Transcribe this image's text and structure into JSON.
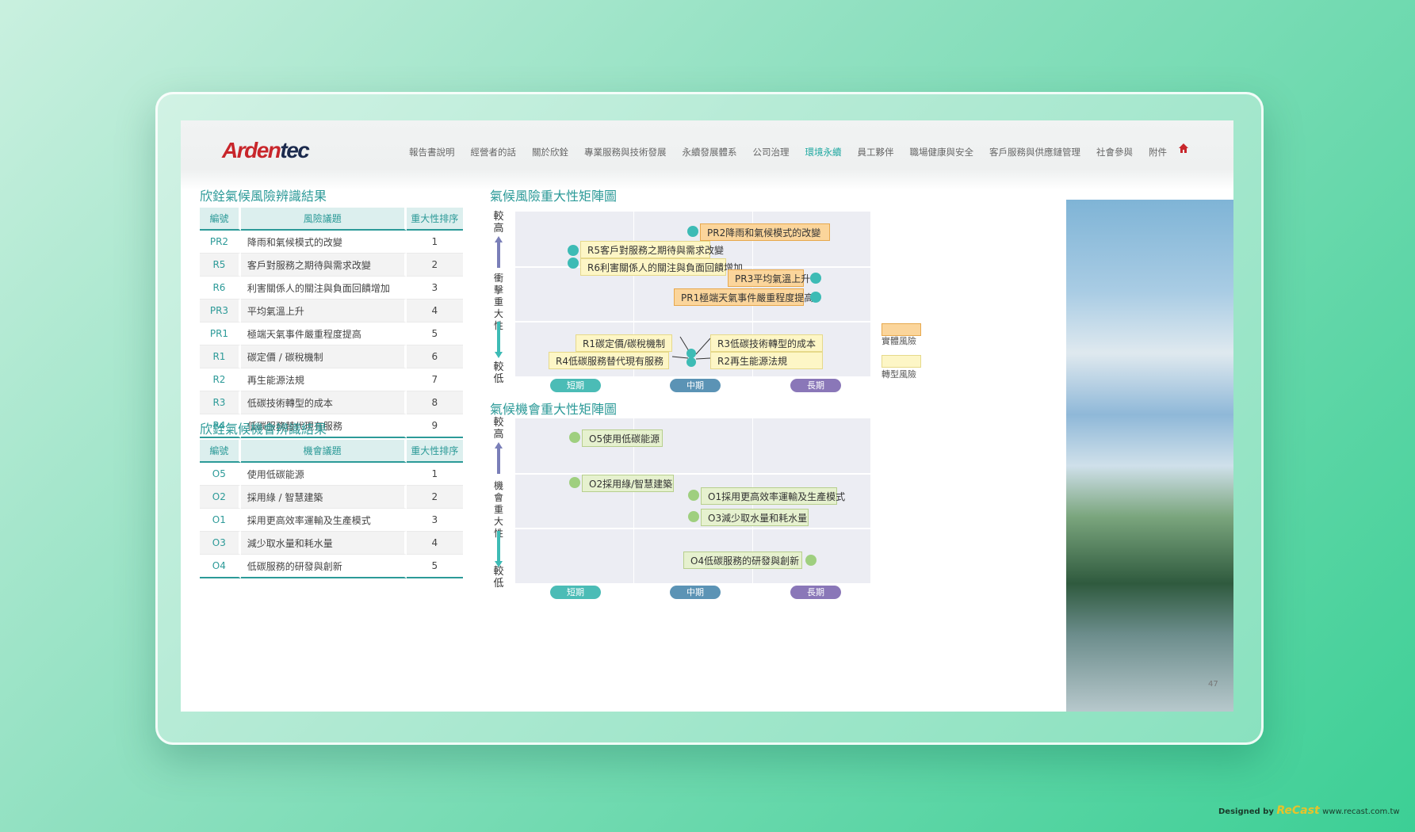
{
  "header": {
    "logo_a": "Arden",
    "logo_b": "tec",
    "nav": [
      "報告書說明",
      "經營者的話",
      "關於欣銓",
      "專業服務與技術發展",
      "永續發展體系",
      "公司治理",
      "環境永續",
      "員工夥伴",
      "職場健康與安全",
      "客戶服務與供應鏈管理",
      "社會參與",
      "附件"
    ],
    "active_index": 6,
    "home_icon": "home-icon"
  },
  "risk_table": {
    "title": "欣銓氣候風險辨識結果",
    "headers": [
      "編號",
      "風險議題",
      "重大性排序"
    ],
    "rows": [
      {
        "id": "PR2",
        "name": "降雨和氣候模式的改變",
        "rank": "1"
      },
      {
        "id": "R5",
        "name": "客戶對服務之期待與需求改變",
        "rank": "2"
      },
      {
        "id": "R6",
        "name": "利害關係人的關注與負面回饋增加",
        "rank": "3"
      },
      {
        "id": "PR3",
        "name": "平均氣溫上升",
        "rank": "4"
      },
      {
        "id": "PR1",
        "name": "極端天氣事件嚴重程度提高",
        "rank": "5"
      },
      {
        "id": "R1",
        "name": "碳定價 / 碳稅機制",
        "rank": "6"
      },
      {
        "id": "R2",
        "name": "再生能源法規",
        "rank": "7"
      },
      {
        "id": "R3",
        "name": "低碳技術轉型的成本",
        "rank": "8"
      },
      {
        "id": "R4",
        "name": "低碳服務替代現有服務",
        "rank": "9"
      }
    ]
  },
  "opp_table": {
    "title": "欣銓氣候機會辨識結果",
    "headers": [
      "編號",
      "機會議題",
      "重大性排序"
    ],
    "rows": [
      {
        "id": "O5",
        "name": "使用低碳能源",
        "rank": "1"
      },
      {
        "id": "O2",
        "name": "採用綠 / 智慧建築",
        "rank": "2"
      },
      {
        "id": "O1",
        "name": "採用更高效率運輸及生產模式",
        "rank": "3"
      },
      {
        "id": "O3",
        "name": "減少取水量和耗水量",
        "rank": "4"
      },
      {
        "id": "O4",
        "name": "低碳服務的研發與創新",
        "rank": "5"
      }
    ]
  },
  "risk_matrix": {
    "title": "氣候風險重大性矩陣圖",
    "y_top": "較高",
    "y_mid": "衝擊重大性",
    "y_bottom": "較低",
    "x_labels": [
      "短期",
      "中期",
      "長期"
    ],
    "items": {
      "pr2": "PR2降雨和氣候模式的改變",
      "r5": "R5客戶對服務之期待與需求改變",
      "r6": "R6利害關係人的關注與負面回饋增加",
      "pr3": "PR3平均氣溫上升",
      "pr1": "PR1極端天氣事件嚴重程度提高",
      "r1": "R1碳定價/碳稅機制",
      "r4": "R4低碳服務替代現有服務",
      "r3": "R3低碳技術轉型的成本",
      "r2": "R2再生能源法規"
    },
    "legend": [
      "實體風險",
      "轉型風險"
    ],
    "colors": {
      "physical": "#fbd59b",
      "transition": "#fdf6c6"
    }
  },
  "opp_matrix": {
    "title": "氣候機會重大性矩陣圖",
    "y_top": "較高",
    "y_mid": "機會重大性",
    "y_bottom": "較低",
    "x_labels": [
      "短期",
      "中期",
      "長期"
    ],
    "items": {
      "o5": "O5使用低碳能源",
      "o2": "O2採用綠/智慧建築",
      "o1": "O1採用更高效率運輸及生產模式",
      "o3": "O3減少取水量和耗水量",
      "o4": "O4低碳服務的研發與創新"
    }
  },
  "page_number": "47",
  "credit": {
    "prefix": "Designed by",
    "brand": "ReCast",
    "url": "www.recast.com.tw"
  }
}
